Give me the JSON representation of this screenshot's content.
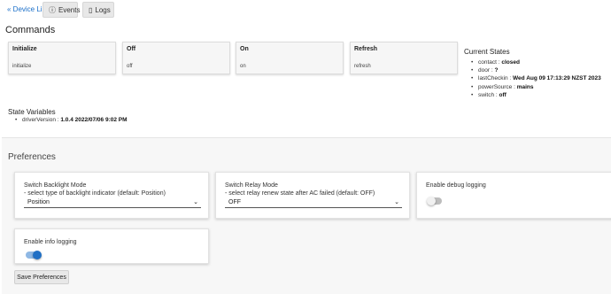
{
  "toolbar": {
    "device_list": "« Device List",
    "events": "Events",
    "logs": "Logs"
  },
  "commands": {
    "title": "Commands",
    "items": [
      {
        "name": "Initialize",
        "value": "initialize"
      },
      {
        "name": "Off",
        "value": "off"
      },
      {
        "name": "On",
        "value": "on"
      },
      {
        "name": "Refresh",
        "value": "refresh"
      }
    ]
  },
  "current_states": {
    "title": "Current States",
    "items": [
      {
        "key": "contact",
        "value": "closed"
      },
      {
        "key": "door",
        "value": "?"
      },
      {
        "key": "lastCheckin",
        "value": "Wed Aug 09 17:13:29 NZST 2023"
      },
      {
        "key": "powerSource",
        "value": "mains"
      },
      {
        "key": "switch",
        "value": "off"
      }
    ]
  },
  "state_variables": {
    "title": "State Variables",
    "items": [
      {
        "key": "driverVersion",
        "value": "1.0.4 2022/07/06 9:02 PM"
      }
    ]
  },
  "preferences": {
    "title": "Preferences",
    "backlight": {
      "title": "Switch Backlight Mode",
      "subtitle": "- select type of backlight indicator (default: Position)",
      "value": "Position"
    },
    "relay": {
      "title": "Switch Relay Mode",
      "subtitle": "- select relay renew state after AC failed (default: OFF)",
      "value": "OFF"
    },
    "debug": {
      "title": "Enable debug logging",
      "enabled": false
    },
    "info": {
      "title": "Enable info logging",
      "enabled": true
    },
    "save_label": "Save Preferences"
  },
  "colors": {
    "link": "#1a6fc9",
    "toggle_on": "#1f6fc5"
  }
}
